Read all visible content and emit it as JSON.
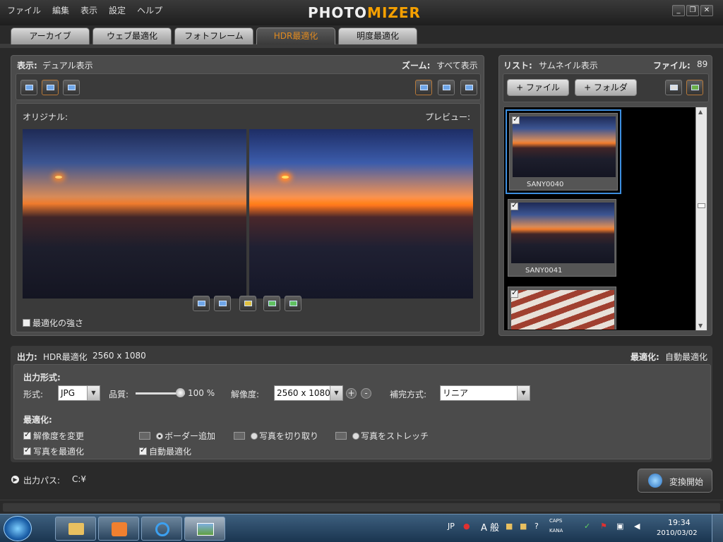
{
  "app": {
    "menu": [
      "ファイル",
      "編集",
      "表示",
      "設定",
      "ヘルプ"
    ],
    "logo_part1": "PHOTO",
    "logo_part2": "MIZER",
    "window_buttons": [
      "_",
      "❐",
      "✕"
    ]
  },
  "tabs": [
    {
      "label": "アーカイブ",
      "active": false
    },
    {
      "label": "ウェブ最適化",
      "active": false
    },
    {
      "label": "フォトフレーム",
      "active": false
    },
    {
      "label": "HDR最適化",
      "active": true
    },
    {
      "label": "明度最適化",
      "active": false
    }
  ],
  "view_panel": {
    "display_label": "表示:",
    "display_value": "デュアル表示",
    "zoom_label": "ズーム:",
    "zoom_value": "すべて表示",
    "original_label": "オリジナル:",
    "preview_label": "プレビュー:",
    "strength_label": "最適化の強さ"
  },
  "list_panel": {
    "list_label": "リスト:",
    "list_value": "サムネイル表示",
    "files_label": "ファイル:",
    "files_count": "89",
    "add_file": "+ ファイル",
    "add_folder": "+ フォルダ",
    "thumbnails": [
      {
        "name": "SANY0040",
        "checked": true,
        "selected": true
      },
      {
        "name": "SANY0041",
        "checked": true,
        "selected": false
      },
      {
        "name": "",
        "checked": true,
        "selected": false
      }
    ]
  },
  "output": {
    "label": "出力:",
    "mode": "HDR最適化",
    "size": "2560 x 1080",
    "optimize_label": "最適化:",
    "optimize_value": "自動最適化",
    "format_section": "出力形式:",
    "format_label": "形式:",
    "format_value": "JPG",
    "quality_label": "品質:",
    "quality_value": "100 %",
    "quality_fraction": 1.0,
    "resolution_label": "解像度:",
    "resolution_value": "2560 x 1080",
    "plus": "+",
    "minus": "-",
    "interp_label": "補完方式:",
    "interp_value": "リニア",
    "opt_section": "最適化:",
    "opt_resize": "解像度を変更",
    "opt_photo": "写真を最適化",
    "opt_auto": "自動最適化",
    "opt_border": "ボーダー追加",
    "opt_crop": "写真を切り取り",
    "opt_stretch": "写真をストレッチ",
    "path_label": "出力パス:",
    "path_value": "C:¥",
    "start_button": "変換開始"
  },
  "taskbar": {
    "ime_lang": "JP",
    "ime_mode": "A 般",
    "caps": "CAPS",
    "kana": "KANA",
    "time": "19:34",
    "date": "2010/03/02"
  },
  "colors": {
    "accent": "#e08a20",
    "selection": "#3d8fe0",
    "panel": "#4b4b4b"
  }
}
